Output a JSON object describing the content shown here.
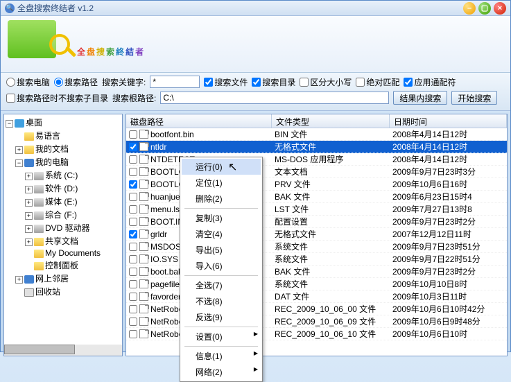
{
  "window": {
    "title": "全盘搜索终结者  v1.2"
  },
  "banner_chars": [
    "全",
    "盘",
    "搜",
    "索",
    "終",
    "結",
    "者"
  ],
  "toolbar": {
    "search_computer": "搜索电脑",
    "search_path": "搜索路径",
    "keyword_label": "搜索关键字:",
    "keyword_value": "*",
    "search_files": "搜索文件",
    "search_dirs": "搜索目录",
    "case_sensitive": "区分大小写",
    "exact_match": "绝对匹配",
    "use_wildcard": "应用通配符",
    "no_subdirs": "搜索路径时不搜索子目录",
    "root_label": "搜索根路径:",
    "root_value": "C:\\",
    "search_in_results": "结果内搜索",
    "start_search": "开始搜索"
  },
  "tree": {
    "desktop": "桌面",
    "easylang": "易语言",
    "mydocs": "我的文档",
    "mycomputer": "我的电脑",
    "drive_c": "系统 (C:)",
    "drive_d": "软件 (D:)",
    "drive_e": "媒体 (E:)",
    "drive_f": "综合 (F:)",
    "dvd": "DVD 驱动器",
    "shared": "共享文档",
    "mydocuments": "My Documents",
    "controlpanel": "控制面板",
    "network": "网上邻居",
    "recycle": "回收站"
  },
  "columns": {
    "path": "磁盘路径",
    "type": "文件类型",
    "date": "日期时间"
  },
  "rows": [
    {
      "chk": false,
      "name": "bootfont.bin",
      "type": "BIN 文件",
      "date": "2008年4月14日12时"
    },
    {
      "chk": true,
      "sel": true,
      "name": "ntldr",
      "type": "无格式文件",
      "date": "2008年4月14日12时"
    },
    {
      "chk": false,
      "name": "NTDETECT.",
      "type": "MS-DOS 应用程序",
      "date": "2008年4月14日12时"
    },
    {
      "chk": false,
      "name": "BOOTLOG.",
      "type": "文本文档",
      "date": "2009年9月7日23时3分"
    },
    {
      "chk": true,
      "name": "BOOTLOG.",
      "type": "PRV 文件",
      "date": "2009年10月6日16时"
    },
    {
      "chk": false,
      "name": "huanjue2",
      "type": "BAK 文件",
      "date": "2009年6月23日15时4"
    },
    {
      "chk": false,
      "name": "menu.lst",
      "type": "LST 文件",
      "date": "2009年7月27日13时8"
    },
    {
      "chk": false,
      "name": "BOOT.INI",
      "type": "配置设置",
      "date": "2009年9月7日23时2分"
    },
    {
      "chk": true,
      "name": "grldr",
      "type": "无格式文件",
      "date": "2007年12月12日11时"
    },
    {
      "chk": false,
      "name": "MSDOS.SY",
      "type": "系统文件",
      "date": "2009年9月7日23时51分"
    },
    {
      "chk": false,
      "name": "IO.SYS",
      "type": "系统文件",
      "date": "2009年9月7日22时51分"
    },
    {
      "chk": false,
      "name": "boot.bak",
      "type": "BAK 文件",
      "date": "2009年9月7日23时2分"
    },
    {
      "chk": false,
      "name": "pagefile",
      "type": "系统文件",
      "date": "2009年10月10日8时"
    },
    {
      "chk": false,
      "name": "favorder",
      "type": "DAT 文件",
      "date": "2009年10月3日11时"
    },
    {
      "chk": false,
      "name": "NetRoboc",
      "type": "REC_2009_10_06_00 文件",
      "date": "2009年10月6日10时42分"
    },
    {
      "chk": false,
      "name": "NetRoboc",
      "type": "REC_2009_10_06_09 文件",
      "date": "2009年10月6日9时48分"
    },
    {
      "chk": false,
      "name": "NetRoboc",
      "type": "REC_2009_10_06_10 文件",
      "date": "2009年10月6日10时"
    }
  ],
  "ctx": {
    "run": "运行(0)",
    "locate": "定位(1)",
    "delete": "删除(2)",
    "copy": "复制(3)",
    "clear": "清空(4)",
    "export": "导出(5)",
    "import": "导入(6)",
    "selectall": "全选(7)",
    "none": "不选(8)",
    "invert": "反选(9)",
    "settings": "设置(0)",
    "info": "信息(1)",
    "network": "网络(2)"
  }
}
